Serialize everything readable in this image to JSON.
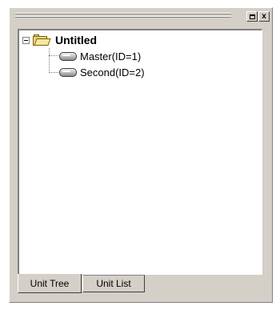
{
  "window": {
    "buttons": [
      {
        "name": "maximize",
        "icon": "maximize-icon"
      },
      {
        "name": "close",
        "icon": "close-icon",
        "glyph": "x"
      }
    ]
  },
  "tree": {
    "root": {
      "label": "Untitled",
      "icon": "folder-icon",
      "expanded": true
    },
    "children": [
      {
        "label": "Master(ID=1)",
        "icon": "unit-icon"
      },
      {
        "label": "Second(ID=2)",
        "icon": "unit-icon"
      }
    ]
  },
  "tabs": [
    {
      "label": "Unit Tree",
      "active": true
    },
    {
      "label": "Unit List",
      "active": false
    }
  ]
}
